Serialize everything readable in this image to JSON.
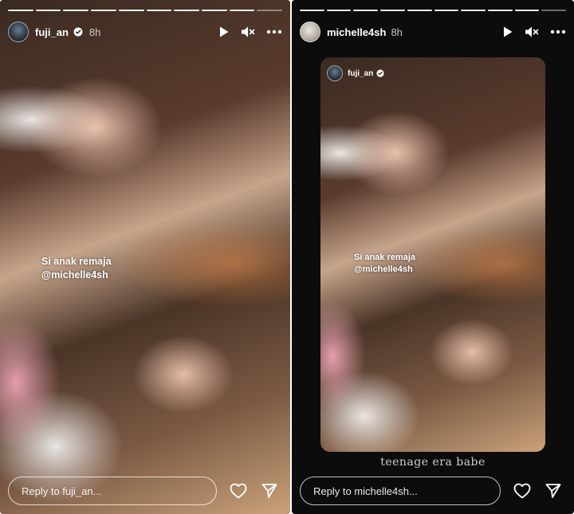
{
  "left_story": {
    "username": "fuji_an",
    "time": "8h",
    "progress_total": 10,
    "progress_done": 9,
    "caption_line1": "Si anak remaja",
    "caption_mention": "@michelle4sh",
    "reply_placeholder": "Reply to fuji_an..."
  },
  "right_story": {
    "username": "michelle4sh",
    "time": "8h",
    "progress_total": 10,
    "progress_done": 9,
    "shared_post": {
      "author": "fuji_an",
      "caption_line1": "Si anak remaja",
      "caption_mention": "@michelle4sh"
    },
    "overlay_text": "teenage era babe",
    "reply_placeholder": "Reply to michelle4sh..."
  },
  "icons": {
    "play": "play-icon",
    "mute": "mute-icon",
    "more": "more-icon",
    "heart": "heart-icon",
    "send": "send-icon",
    "verified": "verified-badge-icon"
  },
  "colors": {
    "verified_badge": "#ffffff",
    "story_bg": "#0c0c0c"
  }
}
